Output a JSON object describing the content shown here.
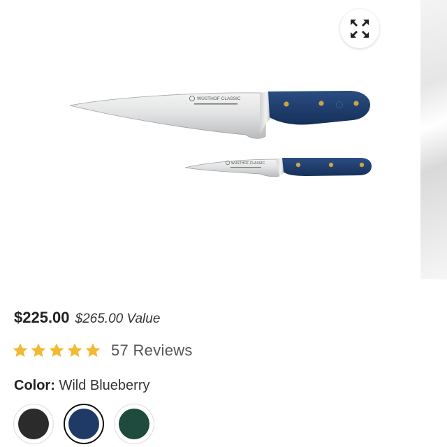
{
  "gallery": {
    "expand_icon": "expand-arrows-icon",
    "knife_brand_large": "WÜSTHOF CLASSIC",
    "knife_brand_small": "WÜSTHOF CLASSIC"
  },
  "product": {
    "price": "$225.00",
    "compare_value": "$265.00 Value",
    "rating": 5,
    "reviews_label": "57 Reviews",
    "color_label": "Color:",
    "color_value": "Wild Blueberry",
    "swatches": [
      {
        "name": "Black",
        "color": "#2b2b2b"
      },
      {
        "name": "Wild Blueberry",
        "color": "#1f3a66",
        "selected": true
      },
      {
        "name": "Green",
        "color": "#1f4a3e"
      }
    ]
  },
  "colors": {
    "star": "#f2b932",
    "handle": "#1f3d6b",
    "rivet": "#c9a24a"
  }
}
